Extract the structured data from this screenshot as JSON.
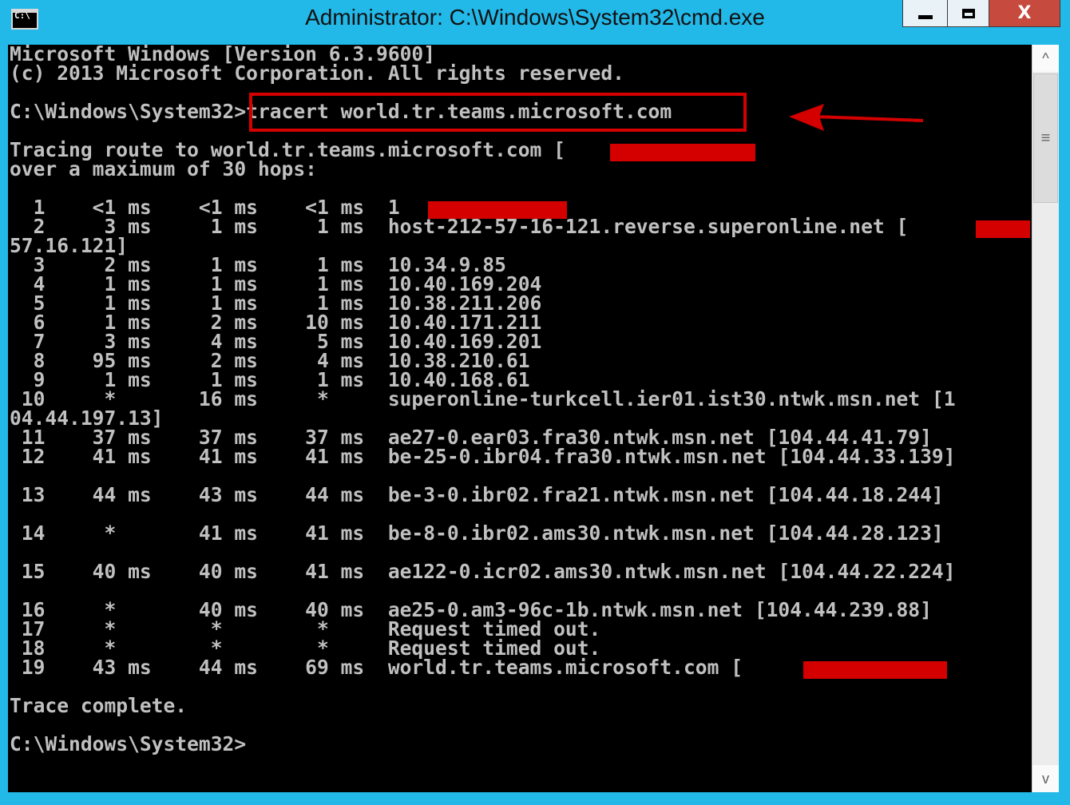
{
  "window": {
    "title": "Administrator: C:\\Windows\\System32\\cmd.exe",
    "icon": "cmd-icon",
    "icon_text": "C:\\",
    "close_label": "X",
    "accent": "#22b8e8"
  },
  "console": {
    "lines": [
      "Microsoft Windows [Version 6.3.9600]",
      "(c) 2013 Microsoft Corporation. All rights reserved.",
      "",
      "C:\\Windows\\System32>tracert world.tr.teams.microsoft.com",
      "",
      "Tracing route to world.tr.teams.microsoft.com [",
      "over a maximum of 30 hops:",
      "",
      "  1    <1 ms    <1 ms    <1 ms  1",
      "  2     3 ms     1 ms     1 ms  host-212-57-16-121.reverse.superonline.net [",
      "57.16.121]",
      "  3     2 ms     1 ms     1 ms  10.34.9.85",
      "  4     1 ms     1 ms     1 ms  10.40.169.204",
      "  5     1 ms     1 ms     1 ms  10.38.211.206",
      "  6     1 ms     2 ms    10 ms  10.40.171.211",
      "  7     3 ms     4 ms     5 ms  10.40.169.201",
      "  8    95 ms     2 ms     4 ms  10.38.210.61",
      "  9     1 ms     1 ms     1 ms  10.40.168.61",
      " 10     *       16 ms     *     superonline-turkcell.ier01.ist30.ntwk.msn.net [1",
      "04.44.197.13]",
      " 11    37 ms    37 ms    37 ms  ae27-0.ear03.fra30.ntwk.msn.net [104.44.41.79]",
      " 12    41 ms    41 ms    41 ms  be-25-0.ibr04.fra30.ntwk.msn.net [104.44.33.139]",
      "",
      " 13    44 ms    43 ms    44 ms  be-3-0.ibr02.fra21.ntwk.msn.net [104.44.18.244]",
      "",
      " 14     *       41 ms    41 ms  be-8-0.ibr02.ams30.ntwk.msn.net [104.44.28.123]",
      "",
      " 15    40 ms    40 ms    41 ms  ae122-0.icr02.ams30.ntwk.msn.net [104.44.22.224]",
      "",
      " 16     *       40 ms    40 ms  ae25-0.am3-96c-1b.ntwk.msn.net [104.44.239.88]",
      " 17     *        *        *     Request timed out.",
      " 18     *        *        *     Request timed out.",
      " 19    43 ms    44 ms    69 ms  world.tr.teams.microsoft.com [",
      "",
      "Trace complete.",
      "",
      "C:\\Windows\\System32>"
    ]
  },
  "annotations": {
    "highlight_color": "#d40000",
    "redaction_color": "#d40000"
  },
  "scrollbar": {
    "up_icon": "chevron-up-icon",
    "down_icon": "chevron-down-icon",
    "up_glyph": "^",
    "down_glyph": "v",
    "grip_glyph": "≡"
  }
}
